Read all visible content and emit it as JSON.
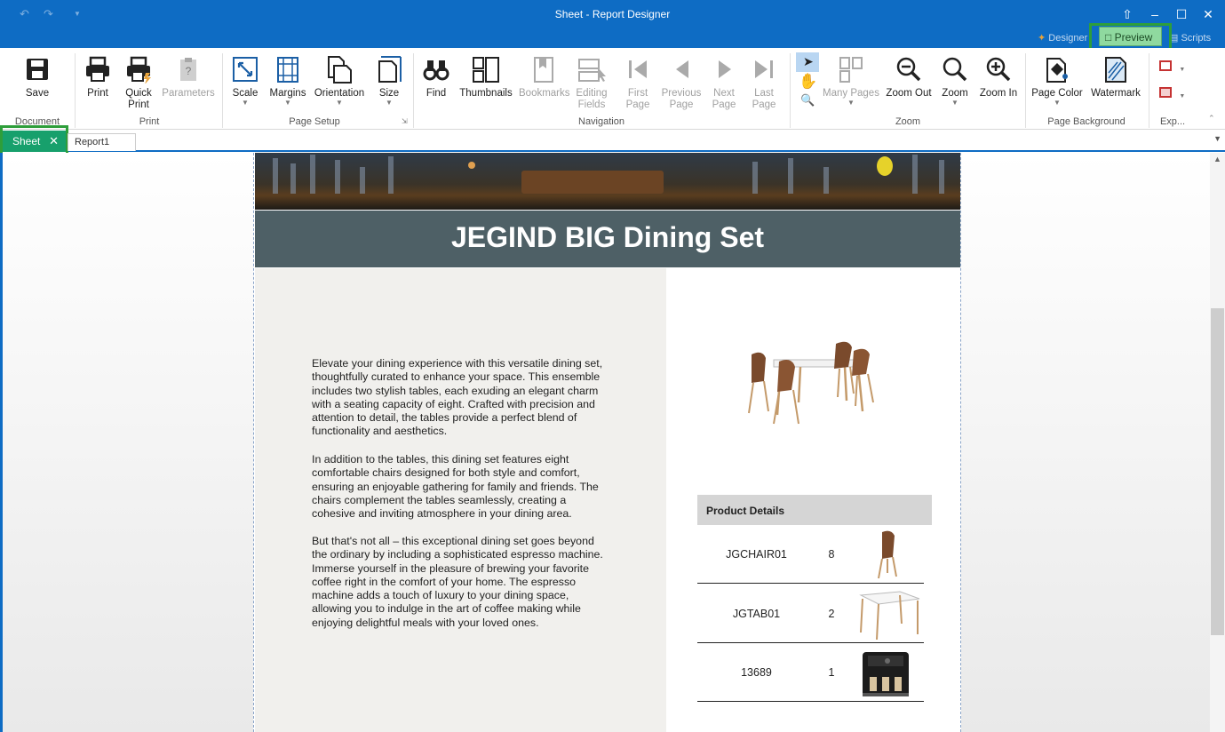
{
  "window": {
    "title": "Sheet - Report Designer",
    "controls": [
      "minimize",
      "maximize",
      "close"
    ]
  },
  "ribbon_tabs": {
    "designer": "Designer",
    "preview": "Preview",
    "scripts": "Scripts"
  },
  "ribbon": {
    "document": {
      "group": "Document",
      "save": "Save"
    },
    "print": {
      "group": "Print",
      "print": "Print",
      "quick_print_1": "Quick",
      "quick_print_2": "Print",
      "parameters": "Parameters"
    },
    "page_setup": {
      "group": "Page Setup",
      "scale": "Scale",
      "margins": "Margins",
      "orientation": "Orientation",
      "size": "Size"
    },
    "navigation": {
      "group": "Navigation",
      "find": "Find",
      "thumbnails": "Thumbnails",
      "bookmarks": "Bookmarks",
      "editing_fields_1": "Editing",
      "editing_fields_2": "Fields",
      "first_page_1": "First",
      "first_page_2": "Page",
      "previous_page_1": "Previous",
      "previous_page_2": "Page",
      "next_page_1": "Next",
      "next_page_2": "Page",
      "last_page_1": "Last",
      "last_page_2": "Page"
    },
    "zoom": {
      "group": "Zoom",
      "many_pages": "Many Pages",
      "zoom_out": "Zoom Out",
      "zoom": "Zoom",
      "zoom_in": "Zoom In"
    },
    "page_background": {
      "group": "Page Background",
      "page_color": "Page Color",
      "watermark": "Watermark"
    },
    "export": {
      "group": "Exp..."
    }
  },
  "doc_tabs": {
    "active": "Sheet",
    "other": "Report1"
  },
  "report": {
    "title": "JEGIND BIG Dining Set",
    "paragraphs": [
      "Elevate your dining experience with this versatile dining set, thoughtfully curated to enhance your space. This ensemble includes two stylish tables, each exuding an elegant charm with a seating capacity of eight. Crafted with precision and attention to detail, the tables provide a perfect blend of functionality and aesthetics.",
      "In addition to the tables, this dining set features eight comfortable chairs designed for both style and comfort, ensuring an enjoyable gathering for family and friends. The chairs complement the tables seamlessly, creating a cohesive and inviting atmosphere in your dining area.",
      "But that's not all – this exceptional dining set goes beyond the ordinary by including a sophisticated espresso machine. Immerse yourself in the pleasure of brewing your favorite coffee right in the comfort of your home. The espresso machine adds a touch of luxury to your dining space, allowing you to indulge in the art of coffee making while enjoying delightful meals with your loved ones."
    ],
    "product_details_header": "Product Details",
    "products": [
      {
        "code": "JGCHAIR01",
        "qty": "8",
        "image": "chair"
      },
      {
        "code": "JGTAB01",
        "qty": "2",
        "image": "table"
      },
      {
        "code": "13689",
        "qty": "1",
        "image": "espresso-machine"
      }
    ]
  },
  "colors": {
    "titlebar": "#0e6cc4",
    "active_tab": "#17a06c",
    "title_band": "#4e6066",
    "left_column": "#f1f0ed",
    "highlight": "#2e9e3a"
  }
}
